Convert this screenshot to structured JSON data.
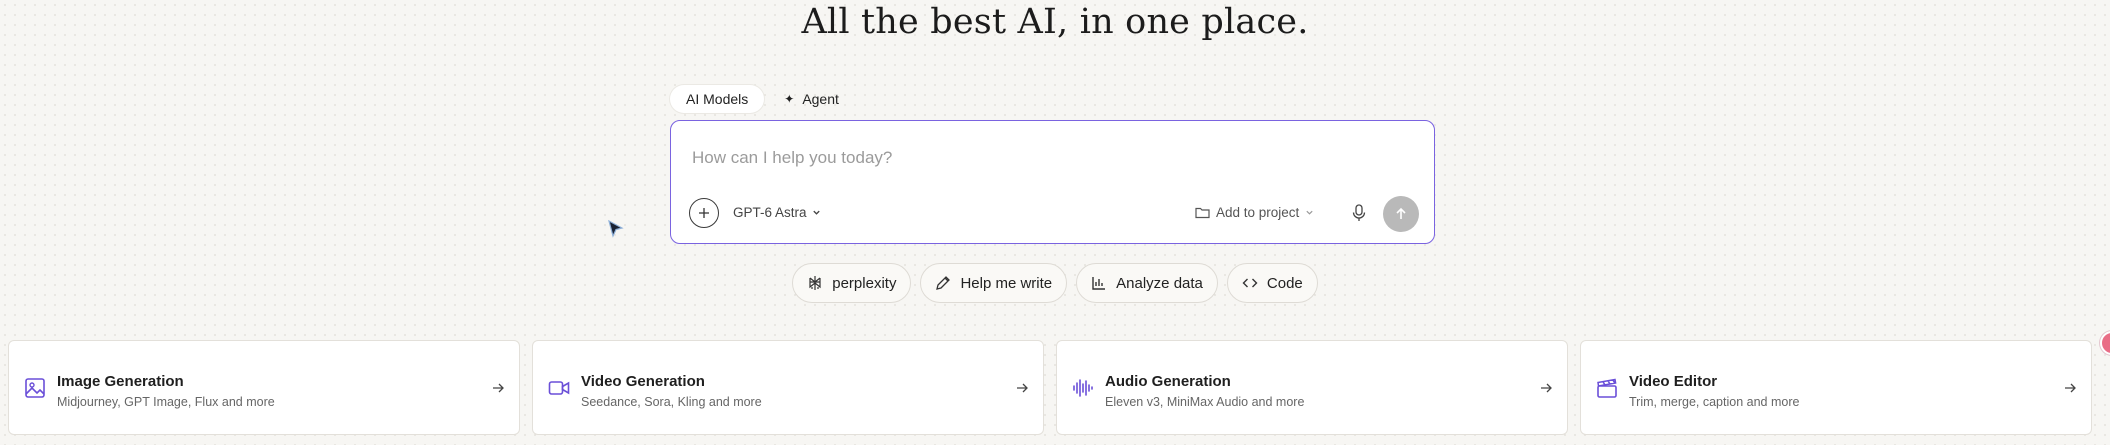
{
  "headline": "All the best AI, in one place.",
  "mode_tabs": [
    {
      "label": "AI Models",
      "active": true
    },
    {
      "label": "Agent",
      "active": false
    }
  ],
  "composer": {
    "placeholder": "How can I help you today?",
    "value": "",
    "model": "GPT-6 Astra",
    "project_label": "Add to project",
    "accent_color": "#7a63e0"
  },
  "chips": [
    {
      "label": "perplexity",
      "icon": "perplexity-icon"
    },
    {
      "label": "Help me write",
      "icon": "pen-icon"
    },
    {
      "label": "Analyze data",
      "icon": "bar-chart-icon"
    },
    {
      "label": "Code",
      "icon": "code-icon"
    }
  ],
  "cards": [
    {
      "title": "Image Generation",
      "subtitle": "Midjourney, GPT Image, Flux and more",
      "icon": "image-icon"
    },
    {
      "title": "Video Generation",
      "subtitle": "Seedance, Sora, Kling and more",
      "icon": "video-camera-icon"
    },
    {
      "title": "Audio Generation",
      "subtitle": "Eleven v3, MiniMax Audio and more",
      "icon": "audio-waveform-icon"
    },
    {
      "title": "Video Editor",
      "subtitle": "Trim, merge, caption and more",
      "icon": "clapperboard-icon"
    }
  ]
}
